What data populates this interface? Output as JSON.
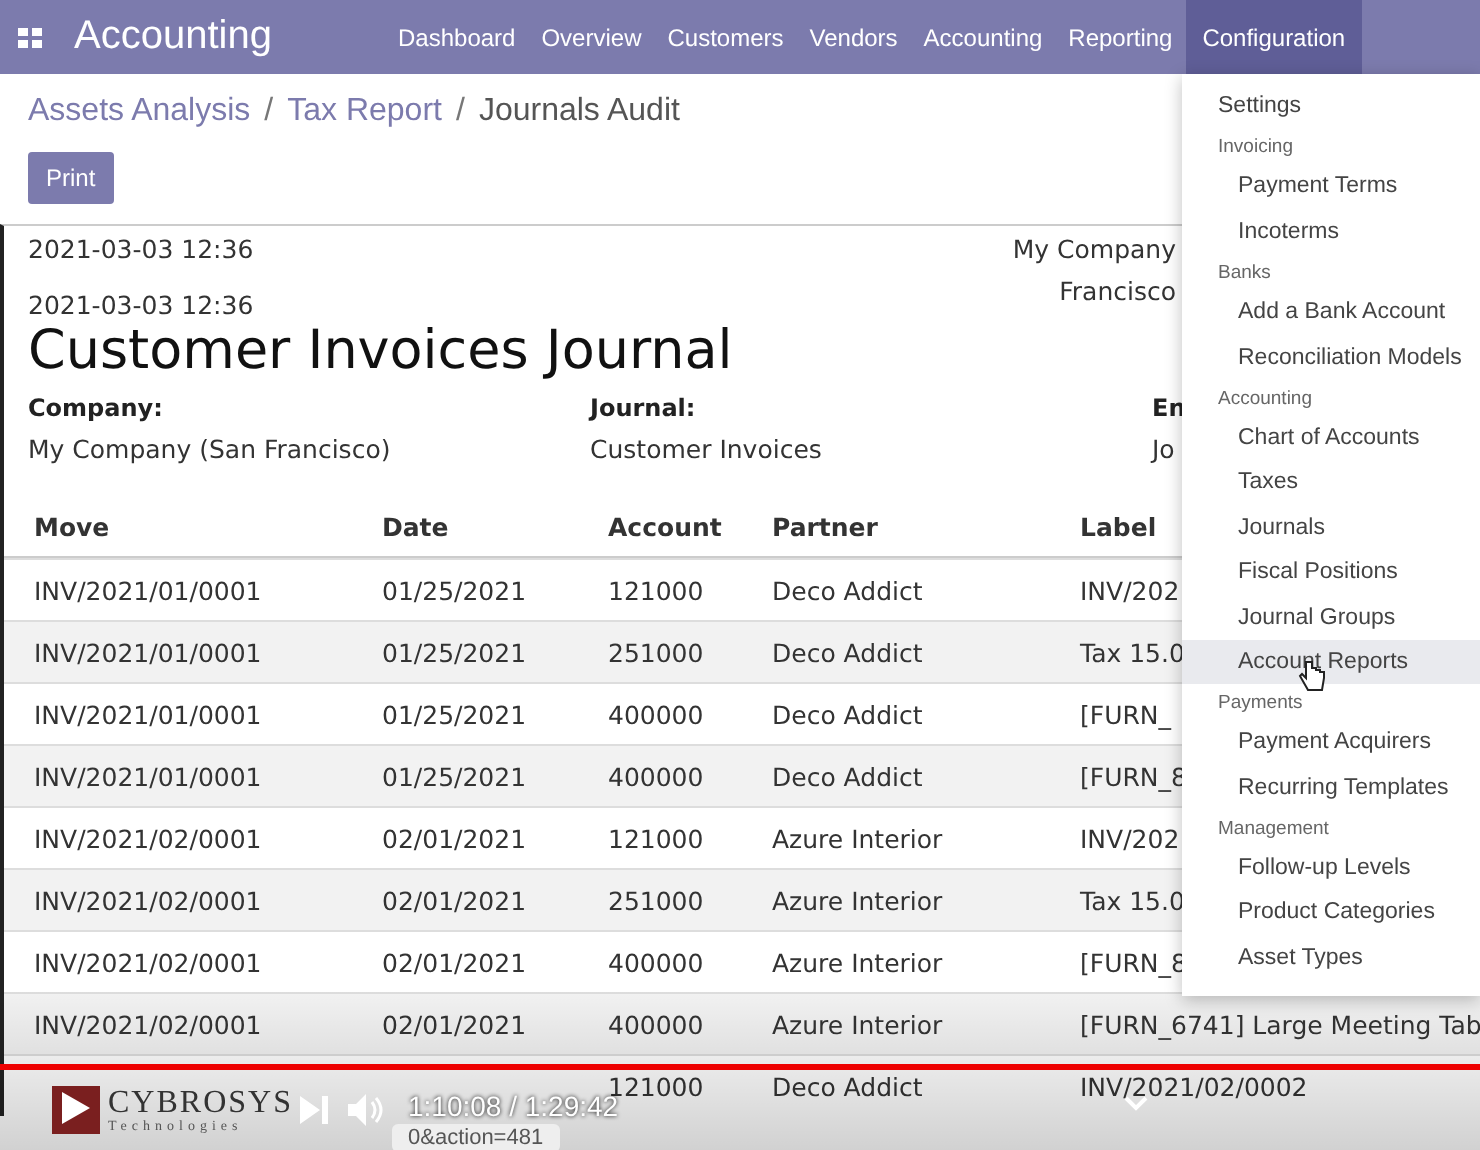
{
  "navbar": {
    "app_title": "Accounting",
    "menus": [
      {
        "label": "Dashboard",
        "selected": false
      },
      {
        "label": "Overview",
        "selected": false
      },
      {
        "label": "Customers",
        "selected": false
      },
      {
        "label": "Vendors",
        "selected": false
      },
      {
        "label": "Accounting",
        "selected": false
      },
      {
        "label": "Reporting",
        "selected": false
      },
      {
        "label": "Configuration",
        "selected": true
      }
    ]
  },
  "breadcrumb": [
    {
      "label": "Assets Analysis",
      "current": false
    },
    {
      "separator": "/",
      "label": "Tax Report",
      "current": false
    },
    {
      "separator": "/",
      "label": "Journals Audit",
      "current": true
    }
  ],
  "print_button": "Print",
  "report": {
    "printed_at": "2021-03-03 12:36",
    "company_header": [
      "My Company",
      "Francisco"
    ],
    "date": "2021-03-03 12:36",
    "title": "Customer Invoices Journal",
    "fields": [
      {
        "label": "Company:",
        "value": "My Company (San Francisco)"
      },
      {
        "label": "Journal:",
        "value": "Customer Invoices"
      },
      {
        "label": "En",
        "value": "Jo"
      }
    ],
    "table": {
      "columns": [
        "Move",
        "Date",
        "Account",
        "Partner",
        "Label"
      ],
      "rows": [
        {
          "move": "INV/2021/01/0001",
          "date": "01/25/2021",
          "account": "121000",
          "partner": "Deco Addict",
          "label": "INV/202"
        },
        {
          "move": "INV/2021/01/0001",
          "date": "01/25/2021",
          "account": "251000",
          "partner": "Deco Addict",
          "label": "Tax 15.0"
        },
        {
          "move": "INV/2021/01/0001",
          "date": "01/25/2021",
          "account": "400000",
          "partner": "Deco Addict",
          "label": "[FURN_"
        },
        {
          "move": "INV/2021/01/0001",
          "date": "01/25/2021",
          "account": "400000",
          "partner": "Deco Addict",
          "label": "[FURN_8"
        },
        {
          "move": "INV/2021/02/0001",
          "date": "02/01/2021",
          "account": "121000",
          "partner": "Azure Interior",
          "label": "INV/202"
        },
        {
          "move": "INV/2021/02/0001",
          "date": "02/01/2021",
          "account": "251000",
          "partner": "Azure Interior",
          "label": "Tax 15.0"
        },
        {
          "move": "INV/2021/02/0001",
          "date": "02/01/2021",
          "account": "400000",
          "partner": "Azure Interior",
          "label": "[FURN_8"
        },
        {
          "move": "INV/2021/02/0001",
          "date": "02/01/2021",
          "account": "400000",
          "partner": "Azure Interior",
          "label": "[FURN_6741] Large Meeting Tab"
        },
        {
          "account": "121000",
          "partner": "Deco Addict",
          "label": "INV/2021/02/0002"
        }
      ]
    }
  },
  "config_menu": [
    {
      "kind": "item",
      "label": "Settings",
      "selected": false
    },
    {
      "kind": "header",
      "label": "Invoicing"
    },
    {
      "kind": "subitem",
      "label": "Payment Terms",
      "selected": false
    },
    {
      "kind": "subitem",
      "label": "Incoterms",
      "selected": false
    },
    {
      "kind": "header",
      "label": "Banks"
    },
    {
      "kind": "subitem",
      "label": "Add a Bank Account",
      "selected": false
    },
    {
      "kind": "subitem",
      "label": "Reconciliation Models",
      "selected": false
    },
    {
      "kind": "header",
      "label": "Accounting"
    },
    {
      "kind": "subitem",
      "label": "Chart of Accounts",
      "selected": false
    },
    {
      "kind": "subitem",
      "label": "Taxes",
      "selected": false
    },
    {
      "kind": "subitem",
      "label": "Journals",
      "selected": false
    },
    {
      "kind": "subitem",
      "label": "Fiscal Positions",
      "selected": false
    },
    {
      "kind": "subitem",
      "label": "Journal Groups",
      "selected": false
    },
    {
      "kind": "subitem",
      "label": "Account Reports",
      "selected": true
    },
    {
      "kind": "header",
      "label": "Payments"
    },
    {
      "kind": "subitem",
      "label": "Payment Acquirers",
      "selected": false
    },
    {
      "kind": "subitem",
      "label": "Recurring Templates",
      "selected": false
    },
    {
      "kind": "header",
      "label": "Management"
    },
    {
      "kind": "subitem",
      "label": "Follow-up Levels",
      "selected": false
    },
    {
      "kind": "subitem",
      "label": "Product Categories",
      "selected": false
    },
    {
      "kind": "subitem",
      "label": "Asset Types",
      "selected": false
    }
  ],
  "video_player": {
    "logo": {
      "name": "CYBROSYS",
      "tagline": "Technologies"
    },
    "time": "1:10:08 / 1:29:42",
    "progress": {
      "level": 1
    },
    "url_fragment": "0&action=481"
  }
}
